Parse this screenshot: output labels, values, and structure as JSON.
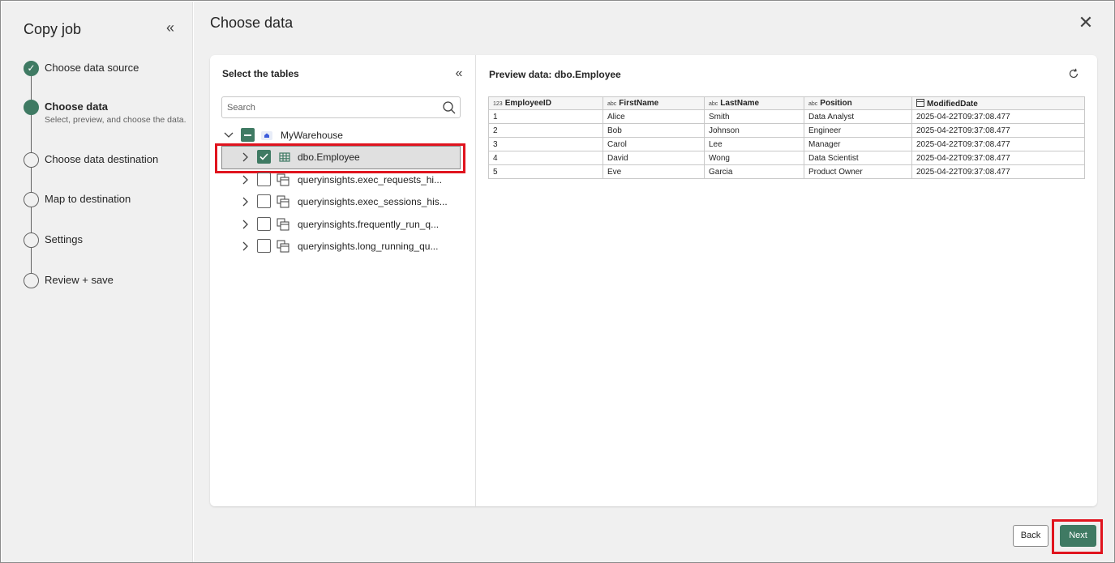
{
  "stepper": {
    "title": "Copy job",
    "steps": [
      {
        "label": "Choose data source",
        "state": "done"
      },
      {
        "label": "Choose data",
        "state": "active",
        "sub": "Select, preview, and choose the data."
      },
      {
        "label": "Choose data destination",
        "state": "pending"
      },
      {
        "label": "Map to destination",
        "state": "pending"
      },
      {
        "label": "Settings",
        "state": "pending"
      },
      {
        "label": "Review + save",
        "state": "pending"
      }
    ]
  },
  "main": {
    "title": "Choose data"
  },
  "tables": {
    "title": "Select the tables",
    "search_placeholder": "Search",
    "root": "MyWarehouse",
    "items": [
      {
        "label": "dbo.Employee",
        "checked": true,
        "selected": true,
        "icon": "table-icon"
      },
      {
        "label": "queryinsights.exec_requests_hi...",
        "checked": false,
        "icon": "view-icon"
      },
      {
        "label": "queryinsights.exec_sessions_his...",
        "checked": false,
        "icon": "view-icon"
      },
      {
        "label": "queryinsights.frequently_run_q...",
        "checked": false,
        "icon": "view-icon"
      },
      {
        "label": "queryinsights.long_running_qu...",
        "checked": false,
        "icon": "view-icon"
      }
    ]
  },
  "preview": {
    "title": "Preview data: dbo.Employee",
    "columns": [
      {
        "type": "123",
        "name": "EmployeeID"
      },
      {
        "type": "abc",
        "name": "FirstName"
      },
      {
        "type": "abc",
        "name": "LastName"
      },
      {
        "type": "abc",
        "name": "Position"
      },
      {
        "type": "calendar",
        "name": "ModifiedDate"
      }
    ],
    "rows": [
      [
        "1",
        "Alice",
        "Smith",
        "Data Analyst",
        "2025-04-22T09:37:08.477"
      ],
      [
        "2",
        "Bob",
        "Johnson",
        "Engineer",
        "2025-04-22T09:37:08.477"
      ],
      [
        "3",
        "Carol",
        "Lee",
        "Manager",
        "2025-04-22T09:37:08.477"
      ],
      [
        "4",
        "David",
        "Wong",
        "Data Scientist",
        "2025-04-22T09:37:08.477"
      ],
      [
        "5",
        "Eve",
        "Garcia",
        "Product Owner",
        "2025-04-22T09:37:08.477"
      ]
    ]
  },
  "footer": {
    "back_label": "Back",
    "next_label": "Next"
  },
  "colors": {
    "accent": "#3f7a63",
    "highlight": "#e0141e"
  }
}
